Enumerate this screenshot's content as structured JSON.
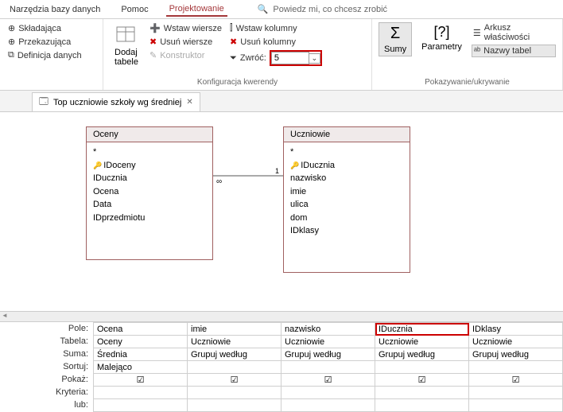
{
  "tabs": {
    "tools": "Narzędzia bazy danych",
    "help": "Pomoc",
    "design": "Projektowanie",
    "tell": "Powiedz mi, co chcesz zrobić"
  },
  "ribbon": {
    "g1": {
      "b1": "Składająca",
      "b2": "Przekazująca",
      "b3": "Definicja danych"
    },
    "g2": {
      "big": "Dodaj\ntabele",
      "b1": "Wstaw wiersze",
      "b2": "Usuń wiersze",
      "b3": "Konstruktor",
      "b4": "Wstaw kolumny",
      "b5": "Usuń kolumny",
      "ret_lbl": "Zwróć:",
      "ret_val": "5",
      "label": "Konfiguracja kwerendy"
    },
    "g3": {
      "big1": "Sumy",
      "big2": "Parametry",
      "b1": "Arkusz właściwości",
      "b2": "Nazwy tabel",
      "label": "Pokazywanie/ukrywanie"
    }
  },
  "doc_tab": "Top uczniowie szkoły wg średniej",
  "tables": {
    "t1": {
      "name": "Oceny",
      "star": "*",
      "fields": [
        "IDoceny",
        "IDucznia",
        "Ocena",
        "Data",
        "IDprzedmiotu"
      ]
    },
    "t2": {
      "name": "Uczniowie",
      "star": "*",
      "fields": [
        "IDucznia",
        "nazwisko",
        "imie",
        "ulica",
        "dom",
        "IDklasy"
      ]
    }
  },
  "grid": {
    "labels": {
      "pole": "Pole:",
      "tabela": "Tabela:",
      "suma": "Suma:",
      "sortuj": "Sortuj:",
      "pokaz": "Pokaż:",
      "kryteria": "Kryteria:",
      "lub": "lub:"
    },
    "cols": [
      {
        "pole": "Ocena",
        "tabela": "Oceny",
        "suma": "Średnia",
        "sortuj": "Malejąco",
        "pokaz": "☑"
      },
      {
        "pole": "imie",
        "tabela": "Uczniowie",
        "suma": "Grupuj według",
        "sortuj": "",
        "pokaz": "☑"
      },
      {
        "pole": "nazwisko",
        "tabela": "Uczniowie",
        "suma": "Grupuj według",
        "sortuj": "",
        "pokaz": "☑"
      },
      {
        "pole": "IDucznia",
        "tabela": "Uczniowie",
        "suma": "Grupuj według",
        "sortuj": "",
        "pokaz": "☑",
        "hl": true
      },
      {
        "pole": "IDklasy",
        "tabela": "Uczniowie",
        "suma": "Grupuj według",
        "sortuj": "",
        "pokaz": "☑"
      }
    ]
  }
}
